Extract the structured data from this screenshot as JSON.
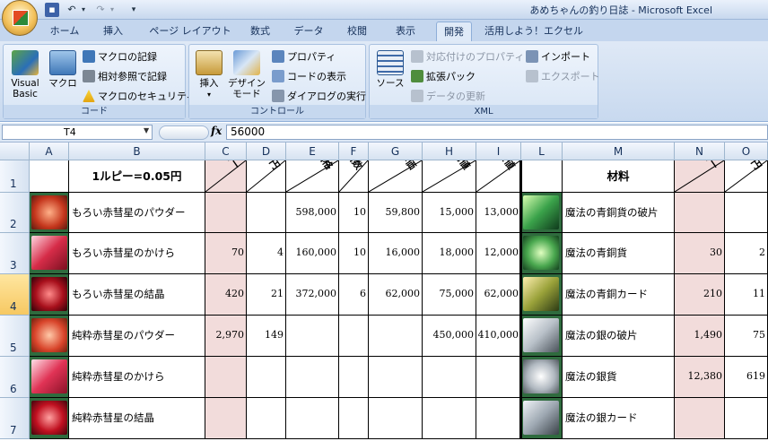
{
  "window": {
    "title": "あめちゃんの釣り日誌 - Microsoft Excel"
  },
  "tabs": [
    "ホーム",
    "挿入",
    "ページ レイアウト",
    "数式",
    "データ",
    "校閲",
    "表示",
    "開発",
    "活用しよう！エクセル"
  ],
  "active_tab": "開発",
  "ribbon": {
    "code": {
      "label": "コード",
      "visual_basic": "Visual Basic",
      "macro": "マクロ",
      "record_macro": "マクロの記録",
      "relative_ref": "相対参照で記録",
      "macro_security": "マクロのセキュリティ"
    },
    "controls": {
      "label": "コントロール",
      "insert": "挿入",
      "design_mode": "デザイン モード",
      "properties": "プロパティ",
      "view_code": "コードの表示",
      "run_dialog": "ダイアログの実行"
    },
    "xml": {
      "label": "XML",
      "source": "ソース",
      "map_props": "対応付けのプロパティ",
      "expansion_packs": "拡張パック",
      "refresh_data": "データの更新",
      "import": "インポート",
      "export": "エクスポート"
    }
  },
  "formula_bar": {
    "name_box": "T4",
    "fx": "fx",
    "formula": "56000"
  },
  "columns": [
    "A",
    "B",
    "C",
    "D",
    "E",
    "F",
    "G",
    "H",
    "I",
    "L",
    "M",
    "N",
    "O"
  ],
  "rows": [
    "1",
    "2",
    "3",
    "4",
    "5",
    "6",
    "7"
  ],
  "selected_row": "4",
  "header": {
    "b1": "1ルピー=0.05円",
    "c1": "ルピー",
    "d1": "円",
    "e1": "価格",
    "f1": "個数",
    "g1": "単価",
    "h1": "高値",
    "i1": "安値",
    "m1": "材料",
    "n1": "ルピー",
    "o1": "円"
  },
  "left_items": [
    {
      "name": "もろい赤彗星のパウダー",
      "rupee": "",
      "yen": "",
      "price": "598,000",
      "count": "10",
      "unit": "59,800",
      "high": "15,000",
      "low": "13,000"
    },
    {
      "name": "もろい赤彗星のかけら",
      "rupee": "70",
      "yen": "4",
      "price": "160,000",
      "count": "10",
      "unit": "16,000",
      "high": "18,000",
      "low": "12,000"
    },
    {
      "name": "もろい赤彗星の結晶",
      "rupee": "420",
      "yen": "21",
      "price": "372,000",
      "count": "6",
      "unit": "62,000",
      "high": "75,000",
      "low": "62,000"
    },
    {
      "name": "純粋赤彗星のパウダー",
      "rupee": "2,970",
      "yen": "149",
      "price": "",
      "count": "",
      "unit": "",
      "high": "450,000",
      "low": "410,000"
    },
    {
      "name": "純粋赤彗星のかけら",
      "rupee": "",
      "yen": "",
      "price": "",
      "count": "",
      "unit": "",
      "high": "",
      "low": ""
    },
    {
      "name": "純粋赤彗星の結晶",
      "rupee": "",
      "yen": "",
      "price": "",
      "count": "",
      "unit": "",
      "high": "",
      "low": ""
    }
  ],
  "right_items": [
    {
      "name": "魔法の青銅貨の破片",
      "rupee": "",
      "yen": ""
    },
    {
      "name": "魔法の青銅貨",
      "rupee": "30",
      "yen": "2"
    },
    {
      "name": "魔法の青銅カード",
      "rupee": "210",
      "yen": "11"
    },
    {
      "name": "魔法の銀の破片",
      "rupee": "1,490",
      "yen": "75"
    },
    {
      "name": "魔法の銀貨",
      "rupee": "12,380",
      "yen": "619"
    },
    {
      "name": "魔法の銀カード",
      "rupee": "",
      "yen": ""
    }
  ]
}
